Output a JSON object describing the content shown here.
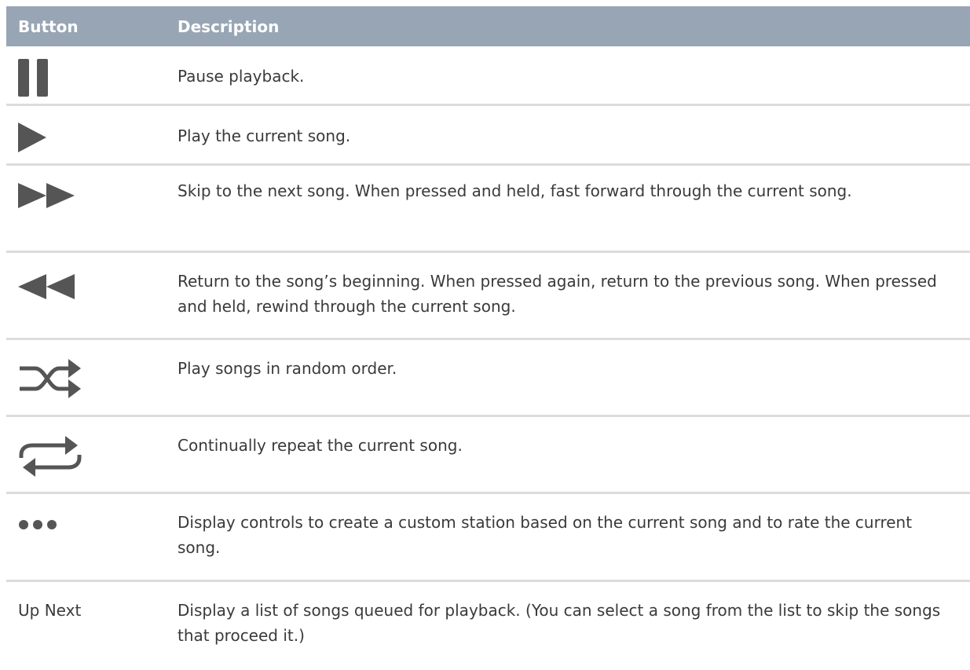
{
  "header": {
    "button": "Button",
    "description": "Description"
  },
  "rows": [
    {
      "icon": "pause-icon",
      "description": "Pause playback."
    },
    {
      "icon": "play-icon",
      "description": "Play the current song."
    },
    {
      "icon": "fast-forward-icon",
      "description": "Skip to the next song. When pressed and held, fast forward through the current song."
    },
    {
      "icon": "rewind-icon",
      "description": "Return to the song’s beginning. When pressed again, return to the previous song. When pressed and held, rewind through the current song."
    },
    {
      "icon": "shuffle-icon",
      "description": "Play songs in random order."
    },
    {
      "icon": "repeat-icon",
      "description": "Continually repeat the current song."
    },
    {
      "icon": "more-icon",
      "description": "Display controls to create a custom station based on the current song and to rate the current song."
    },
    {
      "label": "Up Next",
      "description": "Display a list of songs queued for playback. (You can select a song from the list to skip the songs that proceed it.)"
    }
  ],
  "colors": {
    "header_bg": "#98a5b5",
    "icon": "#555555",
    "divider": "#dcdcdc"
  }
}
